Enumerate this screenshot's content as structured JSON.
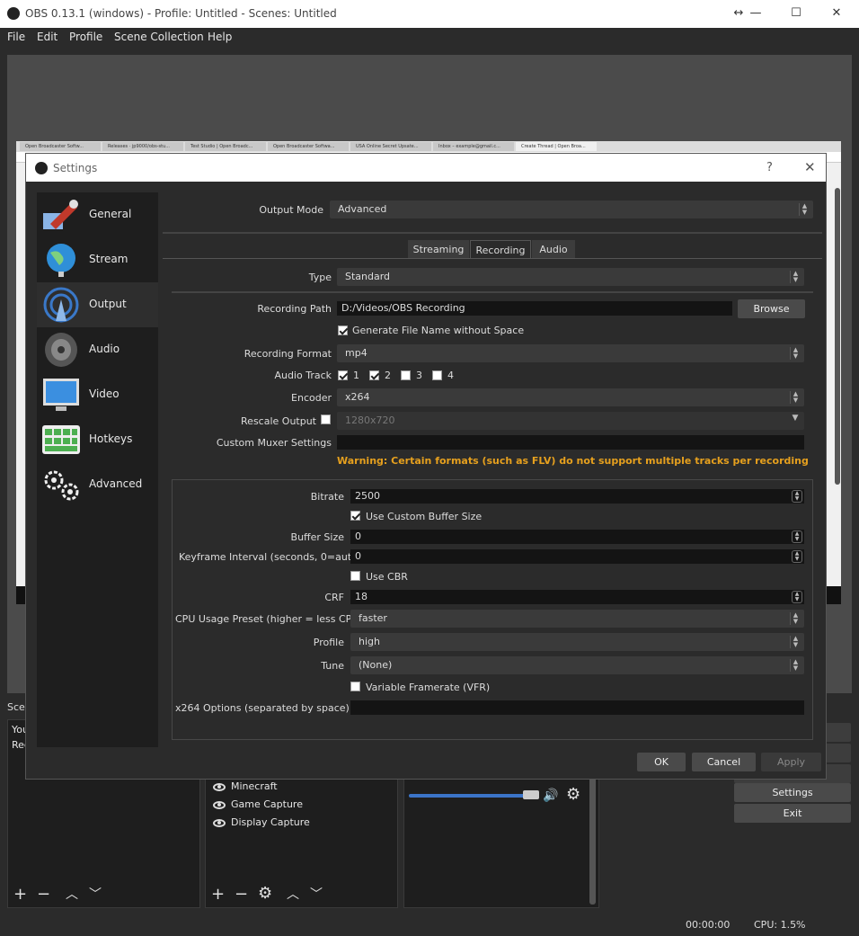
{
  "window": {
    "title": "OBS 0.13.1 (windows) - Profile: Untitled - Scenes: Untitled"
  },
  "menu": [
    "File",
    "Edit",
    "Profile",
    "Scene Collection",
    "Help"
  ],
  "browser_tabs": [
    "Open Broadcaster Softw...",
    "Releases · jp9000/obs-stu...",
    "Test Studio | Open Broadc...",
    "Open Broadcaster Softwa...",
    "USA Online Secret Upsate...",
    "Inbox – example@gmail.c...",
    "Create Thread | Open Broa..."
  ],
  "scenes": {
    "header": "Scen",
    "items": [
      "You",
      "Rec"
    ]
  },
  "sources": [
    "Minecraft",
    "Game Capture",
    "Display Capture"
  ],
  "controls": {
    "settings": "Settings",
    "exit": "Exit"
  },
  "status": {
    "time": "00:00:00",
    "cpu": "CPU: 1.5%"
  },
  "settings": {
    "title": "Settings",
    "help": "?",
    "close": "✕",
    "sidebar": [
      "General",
      "Stream",
      "Output",
      "Audio",
      "Video",
      "Hotkeys",
      "Advanced"
    ],
    "output_mode_label": "Output Mode",
    "output_mode": "Advanced",
    "tabs": [
      "Streaming",
      "Recording",
      "Audio"
    ],
    "type_label": "Type",
    "type": "Standard",
    "path_label": "Recording Path",
    "path": "D:/Videos/OBS Recording",
    "browse": "Browse",
    "gen_filename": "Generate File Name without Space",
    "format_label": "Recording Format",
    "format": "mp4",
    "audio_track_label": "Audio Track",
    "tracks": [
      "1",
      "2",
      "3",
      "4"
    ],
    "encoder_label": "Encoder",
    "encoder": "x264",
    "rescale_label": "Rescale Output",
    "rescale_value": "1280x720",
    "muxer_label": "Custom Muxer Settings",
    "warning": "Warning: Certain formats (such as FLV) do not support multiple tracks per recording",
    "bitrate_label": "Bitrate",
    "bitrate": "2500",
    "custom_buffer": "Use Custom Buffer Size",
    "buffer_label": "Buffer Size",
    "buffer": "0",
    "keyframe_label": "Keyframe Interval (seconds, 0=auto)",
    "keyframe": "0",
    "use_cbr": "Use CBR",
    "crf_label": "CRF",
    "crf": "18",
    "cpu_preset_label": "CPU Usage Preset (higher = less CPU)",
    "cpu_preset": "faster",
    "profile_label": "Profile",
    "profile": "high",
    "tune_label": "Tune",
    "tune": "(None)",
    "vfr": "Variable Framerate (VFR)",
    "x264_label": "x264 Options (separated by space)",
    "ok": "OK",
    "cancel": "Cancel",
    "apply": "Apply",
    "warning_color": "#e6a01e"
  }
}
